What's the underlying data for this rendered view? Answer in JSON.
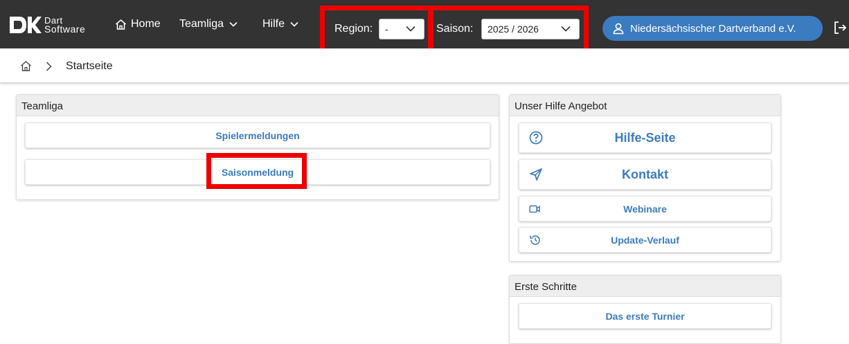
{
  "header": {
    "logo": {
      "line1": "Dart",
      "line2": "Software",
      "mark": "DK"
    },
    "nav": {
      "home": "Home",
      "teamliga": "Teamliga",
      "hilfe": "Hilfe"
    },
    "region": {
      "label": "Region:",
      "value": "-"
    },
    "saison": {
      "label": "Saison:",
      "value": "2025 / 2026"
    },
    "organization": "Niedersächsischer Dartverband e.V.",
    "icons": [
      "home-icon",
      "chevron-down-icon",
      "user-icon",
      "logout-icon"
    ]
  },
  "breadcrumb": {
    "current": "Startseite"
  },
  "teamliga_panel": {
    "title": "Teamliga",
    "buttons": [
      "Spielermeldungen",
      "Saisonmeldung"
    ]
  },
  "hilfe_panel": {
    "title": "Unser Hilfe Angebot",
    "items": [
      {
        "label": "Hilfe-Seite",
        "icon": "help-circle-icon"
      },
      {
        "label": "Kontakt",
        "icon": "send-icon"
      },
      {
        "label": "Webinare",
        "icon": "video-icon"
      },
      {
        "label": "Update-Verlauf",
        "icon": "history-icon"
      }
    ]
  },
  "schritte_panel": {
    "title": "Erste Schritte",
    "items": [
      "Das erste Turnier"
    ]
  },
  "colors": {
    "topbar": "#333333",
    "accent": "#3b7bc0",
    "highlight": "#ee0000"
  }
}
